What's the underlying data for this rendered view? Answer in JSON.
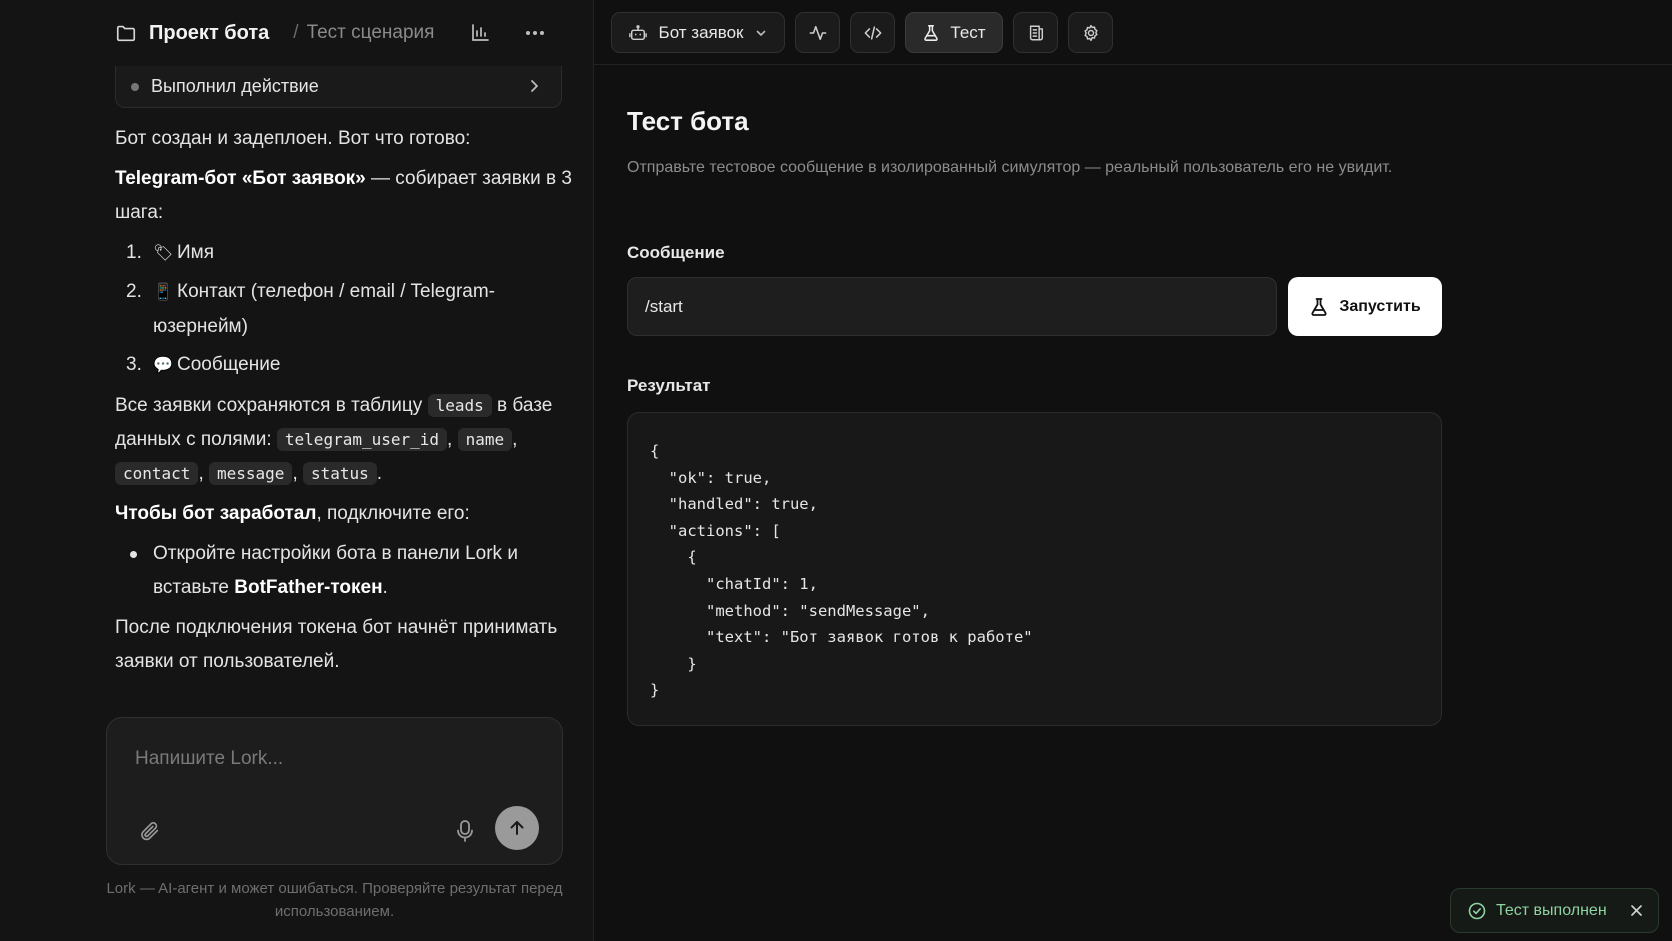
{
  "left": {
    "header": {
      "project_title": "Проект бота",
      "separator": "/",
      "breadcrumb": "Тест сценария"
    },
    "action_row": {
      "label": "Выполнил действие"
    },
    "message": {
      "intro": "Бот создан и задеплоен. Вот что готово:",
      "bot_name": "Telegram-бот «Бот заявок»",
      "bot_desc": " — собирает заявки в 3 шага:",
      "steps": [
        {
          "num": "1.",
          "emoji": "🏷",
          "text": "Имя"
        },
        {
          "num": "2.",
          "emoji": "📱",
          "text": "Контакт (телефон / email / Telegram-юзернейм)"
        },
        {
          "num": "3.",
          "emoji": "💬",
          "text": "Сообщение"
        }
      ],
      "storage_pre": "Все заявки сохраняются в таблицу ",
      "table_name": "leads",
      "storage_mid": " в базе данных с полями: ",
      "fields": [
        "telegram_user_id",
        "name",
        "contact",
        "message",
        "status"
      ],
      "connect_bold": "Чтобы бот заработал",
      "connect_rest": ", подключите его:",
      "bullet_pre": "Откройте настройки бота в панели Lork и вставьте ",
      "bullet_bold": "BotFather-токен",
      "bullet_post": ".",
      "outro": "После подключения токена бот начнёт принимать заявки от пользователей."
    },
    "composer": {
      "placeholder": "Напишите Lork..."
    },
    "disclaimer": "Lork — AI-агент и может ошибаться. Проверяйте результат перед использованием."
  },
  "toolbar": {
    "bot_selector": "Бот заявок",
    "test_tab": "Тест",
    "icons": [
      "bot-icon",
      "chevron-down-icon",
      "activity-icon",
      "code-icon",
      "flask-icon",
      "logs-icon",
      "gear-icon"
    ]
  },
  "main": {
    "title": "Тест бота",
    "description": "Отправьте тестовое сообщение в изолированный симулятор — реальный пользователь его не увидит.",
    "message_label": "Сообщение",
    "message_value": "/start",
    "run_label": "Запустить",
    "result_label": "Результат",
    "result_code": "{\n  \"ok\": true,\n  \"handled\": true,\n  \"actions\": [\n    {\n      \"chatId\": 1,\n      \"method\": \"sendMessage\",\n      \"text\": \"Бот заявок готов к работе\"\n    }\n}"
  },
  "toast": {
    "label": "Тест выполнен",
    "color": "#8fd3a0"
  }
}
